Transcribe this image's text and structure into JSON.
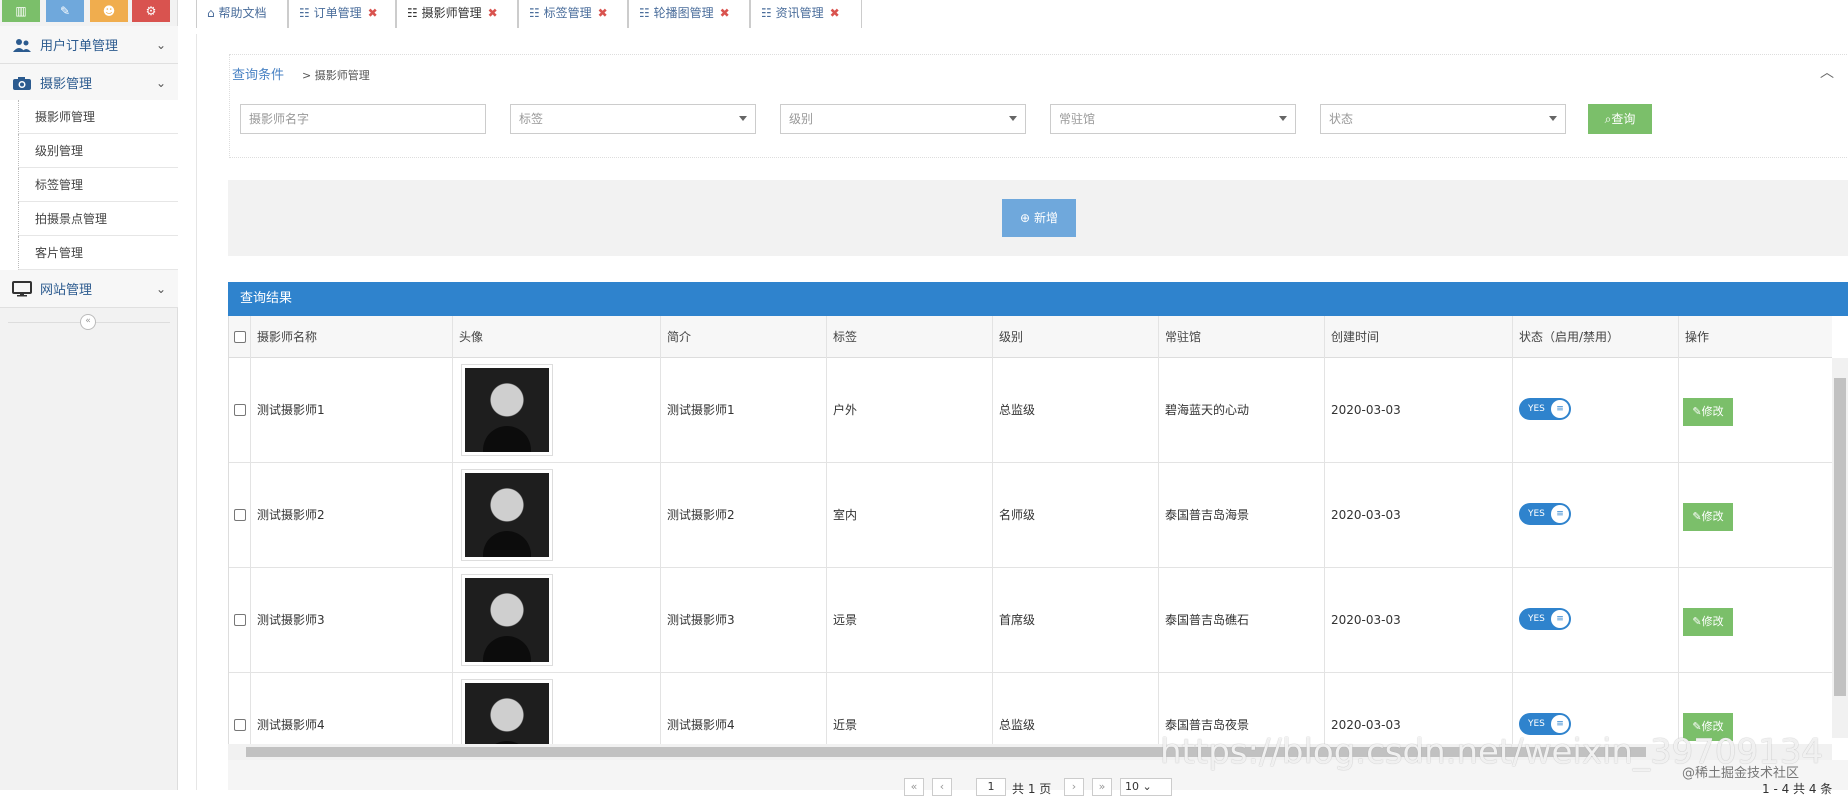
{
  "sidebar": {
    "shortcut_colors": [
      "#7bbf6a",
      "#6fa8dc",
      "#f0ad4e",
      "#d9534f"
    ],
    "groups": [
      {
        "label": "用户订单管理",
        "icon": "users-icon"
      },
      {
        "label": "摄影管理",
        "icon": "camera-icon"
      },
      {
        "label": "网站管理",
        "icon": "monitor-icon"
      }
    ],
    "items": [
      "摄影师管理",
      "级别管理",
      "标签管理",
      "拍摄景点管理",
      "客片管理"
    ]
  },
  "tabs": [
    {
      "label": "帮助文档",
      "closable": false
    },
    {
      "label": "订单管理",
      "closable": true
    },
    {
      "label": "摄影师管理",
      "closable": true
    },
    {
      "label": "标签管理",
      "closable": true
    },
    {
      "label": "轮播图管理",
      "closable": true
    },
    {
      "label": "资讯管理",
      "closable": true
    }
  ],
  "query": {
    "title": "查询条件",
    "crumb": "> 摄影师管理",
    "name_placeholder": "摄影师名字",
    "selects": [
      "标签",
      "级别",
      "常驻馆",
      "状态"
    ],
    "search_label": "查询"
  },
  "add_label": "新增",
  "results": {
    "title": "查询结果",
    "columns": [
      "摄影师名称",
      "头像",
      "简介",
      "标签",
      "级别",
      "常驻馆",
      "创建时间",
      "状态（启用/禁用）",
      "操作"
    ],
    "rows": [
      {
        "name": "测试摄影师1",
        "intro": "测试摄影师1",
        "tag": "户外",
        "level": "总监级",
        "studio": "碧海蓝天的心动",
        "created": "2020-03-03"
      },
      {
        "name": "测试摄影师2",
        "intro": "测试摄影师2",
        "tag": "室内",
        "level": "名师级",
        "studio": "泰国普吉岛海景",
        "created": "2020-03-03"
      },
      {
        "name": "测试摄影师3",
        "intro": "测试摄影师3",
        "tag": "远景",
        "level": "首席级",
        "studio": "泰国普吉岛礁石",
        "created": "2020-03-03"
      },
      {
        "name": "测试摄影师4",
        "intro": "测试摄影师4",
        "tag": "近景",
        "level": "总监级",
        "studio": "泰国普吉岛夜景",
        "created": "2020-03-03"
      }
    ],
    "toggle_label": "YES",
    "edit_label": "修改"
  },
  "pager": {
    "current_page": "1",
    "total_pages": "共 1 页",
    "page_size": "10",
    "summary": "1 - 4   共 4 条"
  },
  "watermark": "https://blog.csdn.net/weixin_39709134",
  "community": "@稀土掘金技术社区"
}
